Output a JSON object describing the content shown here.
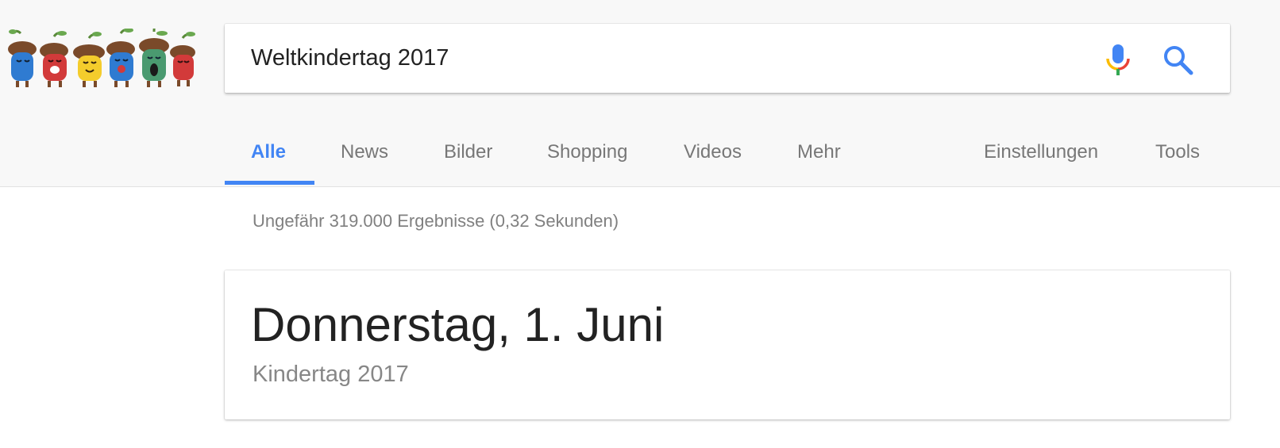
{
  "search": {
    "query": "Weltkindertag 2017"
  },
  "tabs": {
    "items": [
      {
        "label": "Alle",
        "active": true
      },
      {
        "label": "News",
        "active": false
      },
      {
        "label": "Bilder",
        "active": false
      },
      {
        "label": "Shopping",
        "active": false
      },
      {
        "label": "Videos",
        "active": false
      },
      {
        "label": "Mehr",
        "active": false
      }
    ],
    "settings_label": "Einstellungen",
    "tools_label": "Tools"
  },
  "results": {
    "stats": "Ungefähr 319.000 Ergebnisse (0,32 Sekunden)"
  },
  "answer_card": {
    "title": "Donnerstag, 1. Juni",
    "subtitle": "Kindertag 2017"
  },
  "icons": {
    "logo": "doodle-acorns-icon",
    "mic": "microphone-icon",
    "search": "search-icon"
  },
  "colors": {
    "accent": "#4285f4",
    "header_bg": "#f8f8f8",
    "text_muted": "#777777",
    "mic_blue": "#4285f4",
    "mic_red": "#ea4335",
    "mic_yellow": "#fbbc05",
    "mic_green": "#34a853"
  }
}
